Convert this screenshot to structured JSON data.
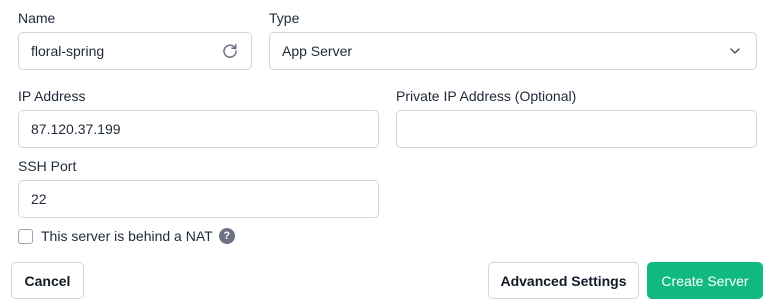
{
  "form": {
    "name": {
      "label": "Name",
      "value": "floral-spring"
    },
    "type": {
      "label": "Type",
      "value": "App Server"
    },
    "ip_address": {
      "label": "IP Address",
      "value": "87.120.37.199"
    },
    "private_ip": {
      "label": "Private IP Address (Optional)",
      "value": ""
    },
    "ssh_port": {
      "label": "SSH Port",
      "value": "22"
    },
    "nat_checkbox": {
      "label": "This server is behind a NAT",
      "checked": false
    }
  },
  "footer": {
    "cancel_label": "Cancel",
    "advanced_label": "Advanced Settings",
    "create_label": "Create Server"
  },
  "icons": {
    "refresh": "refresh-icon",
    "chevron": "chevron-down-icon",
    "help": "question-circle-icon"
  },
  "colors": {
    "primary": "#10b981",
    "border": "#d4d4d8"
  }
}
